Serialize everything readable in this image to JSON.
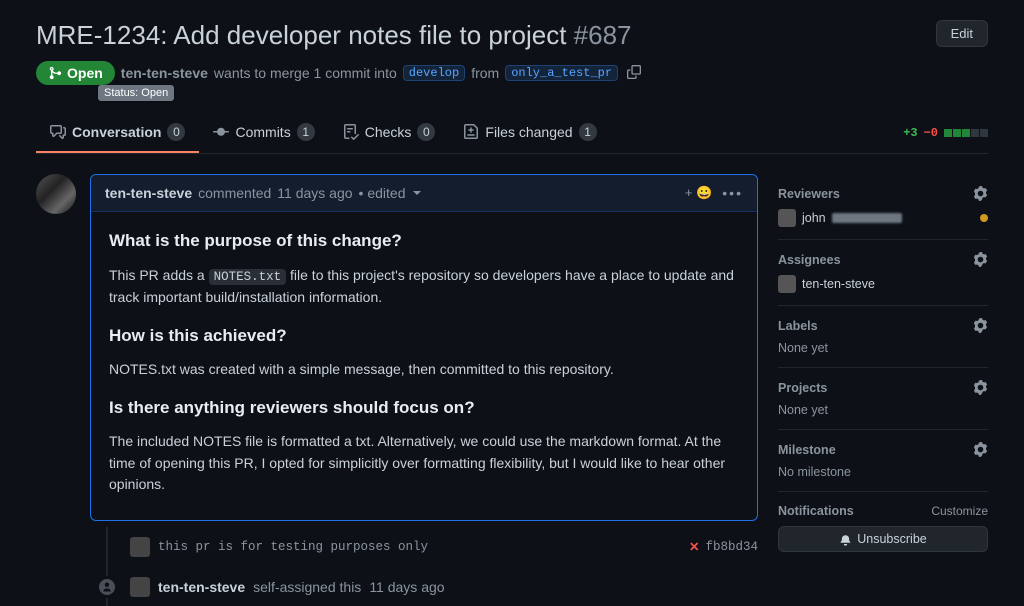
{
  "header": {
    "title": "MRE-1234: Add developer notes file to project",
    "number": "#687",
    "edit": "Edit"
  },
  "meta": {
    "state": "Open",
    "tooltip": "Status: Open",
    "author": "ten-ten-steve",
    "wants": "wants to merge 1 commit into",
    "base": "develop",
    "from": "from",
    "head": "only_a_test_pr"
  },
  "tabs": {
    "conversation": {
      "label": "Conversation",
      "count": "0"
    },
    "commits": {
      "label": "Commits",
      "count": "1"
    },
    "checks": {
      "label": "Checks",
      "count": "0"
    },
    "files": {
      "label": "Files changed",
      "count": "1"
    },
    "diff_add": "+3",
    "diff_del": "−0"
  },
  "comment": {
    "author": "ten-ten-steve",
    "verb": "commented",
    "time": "11 days ago",
    "edited": "• edited",
    "react": "+ 😀",
    "h1": "What is the purpose of this change?",
    "p1a": "This PR adds a ",
    "p1code": "NOTES.txt",
    "p1b": " file to this project's repository so developers have a place to update and track important build/installation information.",
    "h2": "How is this achieved?",
    "p2": "NOTES.txt was created with a simple message, then committed to this repository.",
    "h3": "Is there anything reviewers should focus on?",
    "p3": "The included NOTES file is formatted a txt. Alternatively, we could use the markdown format. At the time of opening this PR, I opted for simplicitly over formatting flexibility, but I would like to hear other opinions."
  },
  "timeline": {
    "commit_msg": "this pr is for testing purposes only",
    "commit_sha": "fb8bd34",
    "self_assign_author": "ten-ten-steve",
    "self_assign_text": "self-assigned this",
    "self_assign_time": "11 days ago"
  },
  "sidebar": {
    "reviewers": {
      "title": "Reviewers",
      "user": "john"
    },
    "assignees": {
      "title": "Assignees",
      "user": "ten-ten-steve"
    },
    "labels": {
      "title": "Labels",
      "value": "None yet"
    },
    "projects": {
      "title": "Projects",
      "value": "None yet"
    },
    "milestone": {
      "title": "Milestone",
      "value": "No milestone"
    },
    "notifications": {
      "title": "Notifications",
      "customize": "Customize",
      "unsubscribe": "Unsubscribe"
    }
  }
}
